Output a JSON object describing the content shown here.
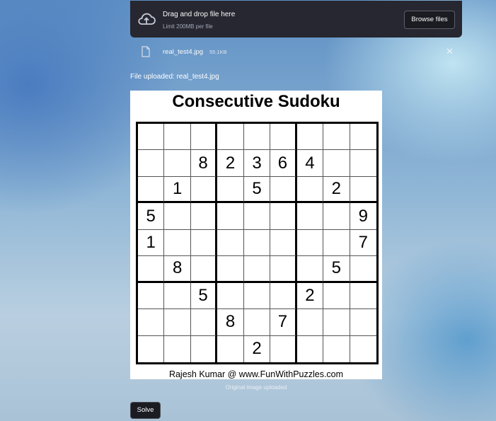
{
  "uploader": {
    "drop_title": "Drag and drop file here",
    "limit": "Limit 200MB per file",
    "browse_label": "Browse files",
    "icon": "cloud-upload-icon"
  },
  "file": {
    "name": "real_test4.jpg",
    "size": "55.1KB",
    "icon": "file-icon",
    "close_icon": "close-icon"
  },
  "status": {
    "uploaded": "File uploaded: real_test4.jpg"
  },
  "puzzle": {
    "title": "Consecutive Sudoku",
    "credit": "Rajesh Kumar @ www.FunWithPuzzles.com",
    "grid": [
      [
        "",
        "",
        "",
        "",
        "",
        "",
        "",
        "",
        ""
      ],
      [
        "",
        "",
        "8",
        "2",
        "3",
        "6",
        "4",
        "",
        ""
      ],
      [
        "",
        "1",
        "",
        "",
        "5",
        "",
        "",
        "2",
        ""
      ],
      [
        "5",
        "",
        "",
        "",
        "",
        "",
        "",
        "",
        "9"
      ],
      [
        "1",
        "",
        "",
        "",
        "",
        "",
        "",
        "",
        "7"
      ],
      [
        "",
        "8",
        "",
        "",
        "",
        "",
        "",
        "5",
        ""
      ],
      [
        "",
        "",
        "5",
        "",
        "",
        "",
        "2",
        "",
        ""
      ],
      [
        "",
        "",
        "",
        "8",
        "",
        "7",
        "",
        "",
        ""
      ],
      [
        "",
        "",
        "",
        "",
        "2",
        "",
        "",
        "",
        ""
      ]
    ]
  },
  "caption": "Original image uploaded",
  "solve_label": "Solve"
}
